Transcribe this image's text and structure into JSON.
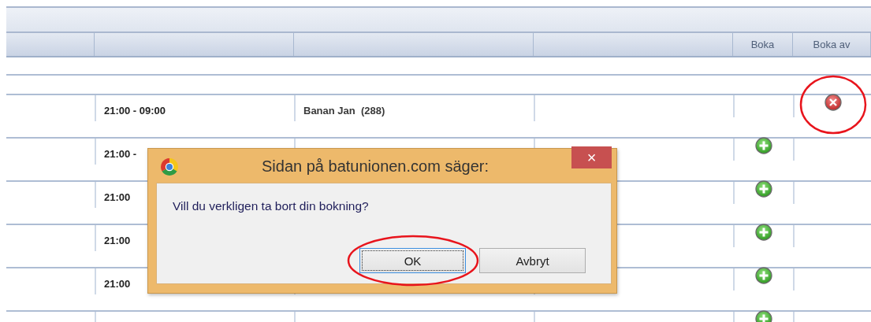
{
  "table": {
    "columns": [
      {
        "label": "Boka"
      },
      {
        "label": "Boka av"
      }
    ],
    "rows": [
      {
        "time": "21:00 - 09:00",
        "name": "Banan Jan  (288)",
        "booked": true,
        "circled": true
      },
      {
        "time": "21:00 -",
        "booked": false,
        "circled": false
      },
      {
        "time": "21:00",
        "booked": false,
        "circled": false
      },
      {
        "time": "21:00",
        "booked": false,
        "circled": false
      },
      {
        "time": "21:00",
        "booked": false,
        "circled": false
      },
      {
        "booked": false,
        "circled": false
      }
    ]
  },
  "dialog": {
    "title": "Sidan på batunionen.com säger:",
    "close": "×",
    "message": "Vill du verkligen ta bort din bokning?",
    "buttons": [
      {
        "label": "OK",
        "focused": true,
        "circled": true
      },
      {
        "label": "Avbryt",
        "focused": false,
        "circled": false
      }
    ]
  }
}
